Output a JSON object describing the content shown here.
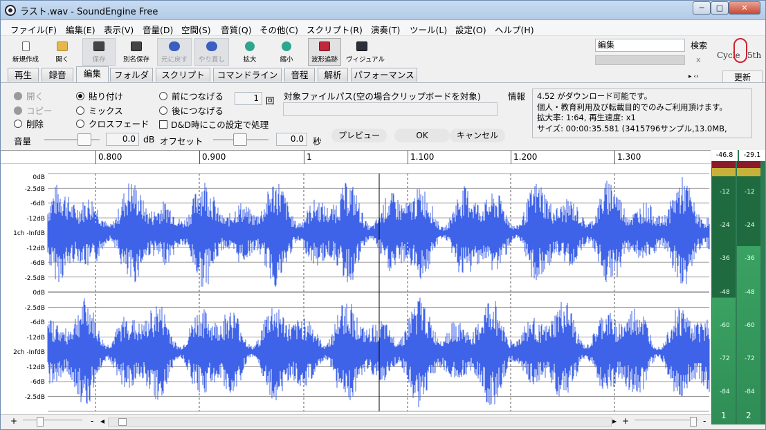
{
  "window": {
    "title": "ラスト.wav - SoundEngine Free",
    "minimize": "─",
    "maximize": "□",
    "close": "✕"
  },
  "menu": [
    "ファイル(F)",
    "編集(E)",
    "表示(V)",
    "音量(D)",
    "空間(S)",
    "音質(Q)",
    "その他(C)",
    "スクリプト(R)",
    "演奏(T)",
    "ツール(L)",
    "設定(O)",
    "ヘルプ(H)"
  ],
  "toolbar": {
    "new": "新規作成",
    "open": "開く",
    "save": "保存",
    "save_as": "別名保存",
    "undo": "元に戻す",
    "redo": "やり直し",
    "zoom_in": "拡大",
    "zoom_out": "縮小",
    "waveform_follow": "波形追跡",
    "visual": "ヴィジュアル"
  },
  "search": {
    "value": "編集",
    "button": "検索",
    "clear": "x"
  },
  "logo": {
    "text_left": "Cycle",
    "text_right": "5th"
  },
  "tabs": [
    "再生",
    "録音",
    "編集",
    "フォルダ",
    "スクリプト",
    "コマンドライン",
    "音程",
    "解析",
    "パフォーマンス"
  ],
  "active_tab": "編集",
  "tab_nav": "▸ ‹›",
  "update_button": "更新",
  "edit": {
    "radio_open": "開く",
    "radio_copy": "コピー",
    "radio_delete": "削除",
    "radio_paste": "貼り付け",
    "radio_mix": "ミックス",
    "radio_crossfade": "クロスフェード",
    "radio_prepend": "前につなげる",
    "radio_append": "後につなげる",
    "dd_checkbox": "D&D時にこの設定で処理",
    "count_value": "1",
    "count_unit": "回",
    "target_path_label": "対象ファイルパス(空の場合クリップボードを対象)",
    "target_path_value": "",
    "volume_label": "音量",
    "volume_value": "0.0",
    "volume_unit": "dB",
    "offset_label": "オフセット",
    "offset_value": "0.0",
    "offset_unit": "秒",
    "preview_button": "プレビュー",
    "ok_button": "OK",
    "cancel_button": "キャンセル",
    "info_label": "情報",
    "info_lines": [
      "4.52 がダウンロード可能です。",
      "個人・教育利用及び転載目的でのみご利用頂けます。",
      "拡大率: 1:64, 再生速度: x1",
      "サイズ: 00:00:35.581 (3415796サンプル,13.0MB,"
    ]
  },
  "ruler": [
    "0.800",
    "0.900",
    "1",
    "1.100",
    "1.200",
    "1.300"
  ],
  "channels": [
    {
      "name": "1ch -InfdB",
      "db_labels": [
        "0dB",
        "-2.5dB",
        "-6dB",
        "-12dB",
        "-12dB",
        "-6dB",
        "-2.5dB"
      ]
    },
    {
      "name": "2ch -InfdB",
      "db_labels": [
        "0dB",
        "-2.5dB",
        "-6dB",
        "-12dB",
        "-12dB",
        "-6dB",
        "-2.5dB"
      ]
    }
  ],
  "waveform_color": "#3f63e8",
  "meters": {
    "left_value": "-46.8",
    "right_value": "-29.1",
    "scale": [
      "-12",
      "-24",
      "-36",
      "-48",
      "-60",
      "-72",
      "-84"
    ],
    "channel_labels": [
      "1",
      "2"
    ],
    "left_level_db": -46.8,
    "right_level_db": -29.1
  },
  "bottom": {
    "plus": "+",
    "minus": "-",
    "left_arrow": "◂",
    "right_arrow": "▸"
  }
}
